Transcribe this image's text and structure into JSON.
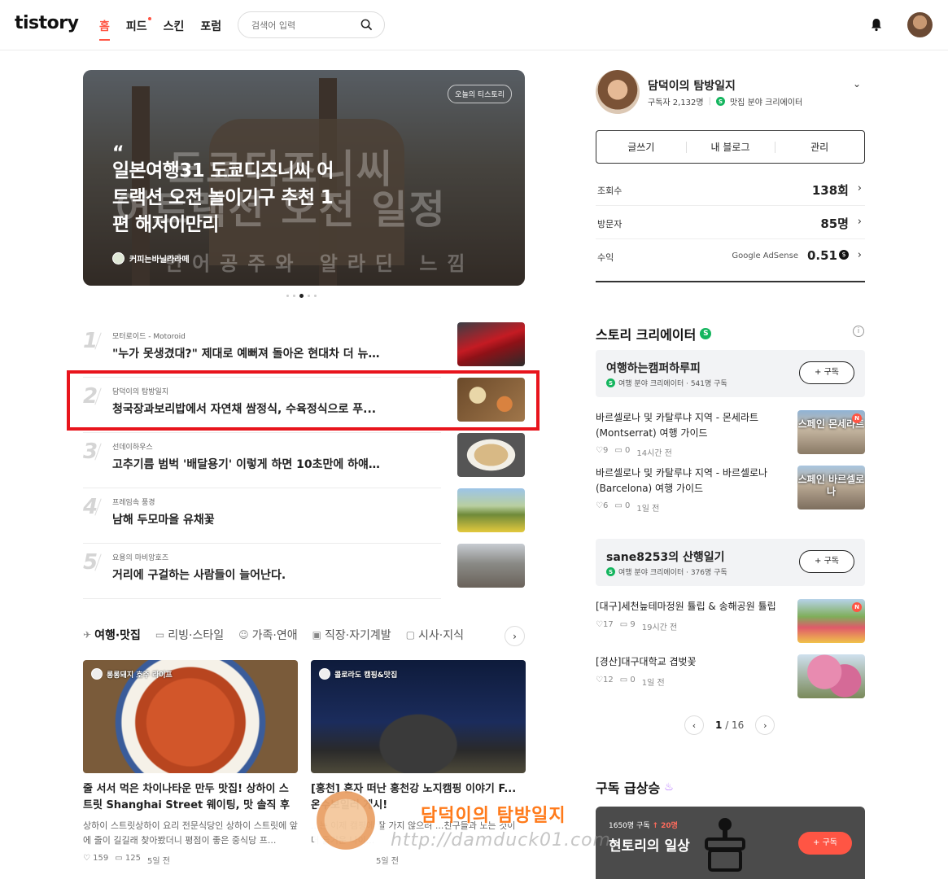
{
  "header": {
    "logo": "tistory",
    "nav": [
      "홈",
      "피드",
      "스킨",
      "포럼"
    ],
    "search_placeholder": "검색어 입력"
  },
  "hero": {
    "badge": "오늘의 티스토리",
    "quote_mark": "“",
    "title": "일본여행31 도쿄디즈니씨 어트랙션 오전 놀이기구 추천 1편 해저이만리",
    "bg_text_1": "도쿄디즈니씨",
    "bg_text_2": "어트랙션 오전 일정",
    "bg_text_3": "인어공주와 알라딘 느낌",
    "author": "커피는바닐라라떼"
  },
  "ranking": [
    {
      "num": "1",
      "source": "모터로이드 - Motoroid",
      "title": "\"누가 못생겼대?\" 제대로 예뻐져 돌아온 현대차 더 뉴 ..."
    },
    {
      "num": "2",
      "source": "담덕이의 탐방일지",
      "title": "청국장과보리밥에서 자연채 쌈정식, 수육정식으로 푸..."
    },
    {
      "num": "3",
      "source": "선데이하우스",
      "title": "고추기름 범벅 '배달용기' 이렇게 하면 10초만에 하얘..."
    },
    {
      "num": "4",
      "source": "프레임속 풍경",
      "title": "남해 두모마을 유채꽃"
    },
    {
      "num": "5",
      "source": "요용의 마비앙호즈",
      "title": "거리에 구걸하는 사람들이 늘어난다."
    }
  ],
  "categories": [
    "여행·맛집",
    "리빙·스타일",
    "가족·연애",
    "직장·자기계발",
    "시사·지식"
  ],
  "cards": [
    {
      "blog": "롱롱돼지 호주 라이프",
      "title": "줄 서서 먹은 차이나타운 만두 맛집! 상하이 스트릿 Shanghai Street 웨이팅, 맛 솔직 후기",
      "summary": "상하이 스트릿상하이 요리 전문식당인 상하이 스트릿에 앞에 줄이 길길래 찾아봤더니 평점이 좋은 중식당 프...",
      "likes": "159",
      "comments": "125",
      "time": "5일 전"
    },
    {
      "blog": "콜로라도 캠핑&맛집",
      "title": "[홍천] 혼자 떠난 홍천강 노지캠핑 이야기 F... 온수보일러 게시!",
      "summary": "...는 이제 캠핑에 잘 가지 않으려 ...친구들과 노는 것이 더 즐거운 나이...",
      "likes": "",
      "comments": "",
      "time": "5일 전"
    }
  ],
  "profile": {
    "name": "담덕이의 탐방일지",
    "subscribers": "구독자 2,132명",
    "creator_field": "맛집 분야 크리에이터",
    "buttons": [
      "글쓰기",
      "내 블로그",
      "관리"
    ],
    "stats": [
      {
        "label": "조회수",
        "value": "138회"
      },
      {
        "label": "방문자",
        "value": "85명"
      },
      {
        "label": "수익",
        "value": "0.51",
        "extra": "Google AdSense"
      }
    ]
  },
  "story_creator": {
    "title": "스토리 크리에이터",
    "creators": [
      {
        "name": "여행하는캠퍼하루피",
        "meta": "여행 분야 크리에이터 · 541명 구독",
        "button": "+ 구독",
        "posts": [
          {
            "title": "바르셀로나 및 카탈루냐 지역 - 몬세라트(Montserrat) 여행 가이드",
            "likes": "9",
            "comments": "0",
            "time": "14시간 전",
            "thumb_caption": "스페인 몬세라트"
          },
          {
            "title": "바르셀로나 및 카탈루냐 지역 - 바르셀로나(Barcelona) 여행 가이드",
            "likes": "6",
            "comments": "0",
            "time": "1일 전",
            "thumb_caption": "스페인 바르셀로나"
          }
        ]
      },
      {
        "name": "sane8253의 산행일기",
        "meta": "여행 분야 크리에이터 · 376명 구독",
        "button": "+ 구독",
        "posts": [
          {
            "title": "[대구]세천늪테마정원 튤립 & 송해공원 튤립",
            "likes": "17",
            "comments": "9",
            "time": "19시간 전",
            "thumb_caption": ""
          },
          {
            "title": "[경산]대구대학교 겹벚꽃",
            "likes": "12",
            "comments": "0",
            "time": "1일 전",
            "thumb_caption": ""
          }
        ]
      }
    ],
    "pager": {
      "current": "1",
      "total": "/ 16"
    }
  },
  "rising": {
    "title": "구독 급상승",
    "count": "1650명 구독",
    "delta": "↑ 20명",
    "name": "현토리의 일상",
    "button": "+ 구독"
  },
  "watermark": {
    "name": "담덕이의 탐방일지",
    "url": "http://damduck01.com"
  }
}
